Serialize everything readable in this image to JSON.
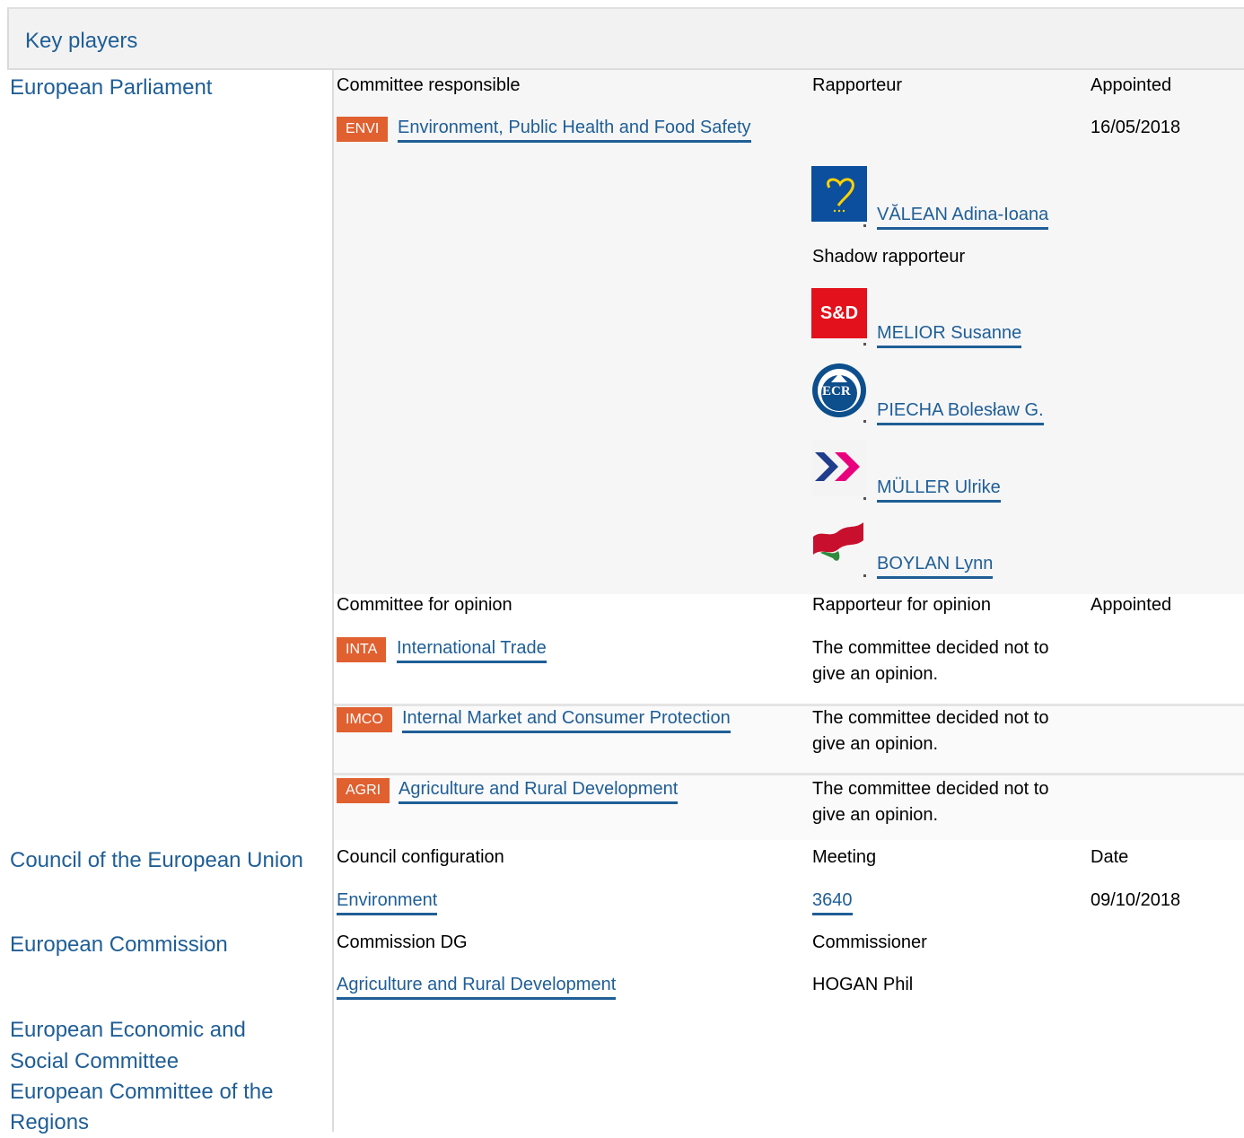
{
  "header": {
    "title": "Key players"
  },
  "institutions": {
    "parliament": "European Parliament",
    "council": "Council of the European Union",
    "commission": "European Commission",
    "eesc_line1": "European Economic and",
    "eesc_line2": "Social Committee",
    "cor_line1": "European Committee of the",
    "cor_line2": "Regions"
  },
  "parliament": {
    "responsible": {
      "col_committee": "Committee responsible",
      "col_rapporteur": "Rapporteur",
      "col_appointed": "Appointed",
      "badge": "ENVI",
      "committee": "Environment, Public Health and Food Safety",
      "appointed": "16/05/2018",
      "rapporteur": {
        "name": "VĂLEAN Adina-Ioana",
        "group_icon": "epp-heart-logo-icon",
        "color": "#0b4f9e"
      },
      "shadow_label": "Shadow rapporteur",
      "shadows": [
        {
          "name": "MELIOR Susanne",
          "group_icon": "sd-logo-icon",
          "logo_text": "S&D",
          "color": "#e3111b"
        },
        {
          "name": "PIECHA Bolesław G.",
          "group_icon": "ecr-logo-icon",
          "logo_text": "ECR",
          "color": "#0d4e8c"
        },
        {
          "name": "MÜLLER Ulrike",
          "group_icon": "renew-chevrons-logo-icon",
          "color": "#e8007d"
        },
        {
          "name": "BOYLAN Lynn",
          "group_icon": "gue-flag-logo-icon",
          "color": "#c8102e"
        }
      ]
    },
    "opinion": {
      "col_committee": "Committee for opinion",
      "col_rapporteur": "Rapporteur for opinion",
      "col_appointed": "Appointed",
      "rows": [
        {
          "badge": "INTA",
          "committee": "International Trade",
          "line1": "The committee decided not to",
          "line2": "give an opinion."
        },
        {
          "badge": "IMCO",
          "committee": "Internal Market and Consumer Protection",
          "line1": "The committee decided not to",
          "line2": "give an opinion."
        },
        {
          "badge": "AGRI",
          "committee": "Agriculture and Rural Development",
          "line1": "The committee decided not to",
          "line2": "give an opinion."
        }
      ]
    }
  },
  "council": {
    "col_config": "Council configuration",
    "col_meeting": "Meeting",
    "col_date": "Date",
    "config": "Environment",
    "meeting": "3640",
    "date": "09/10/2018"
  },
  "commission": {
    "col_dg": "Commission DG",
    "col_commissioner": "Commissioner",
    "dg": "Agriculture and Rural Development",
    "commissioner": "HOGAN Phil"
  },
  "colors": {
    "link": "#1f5e96",
    "badge": "#e06030",
    "header_bg": "#f2f2f2"
  }
}
